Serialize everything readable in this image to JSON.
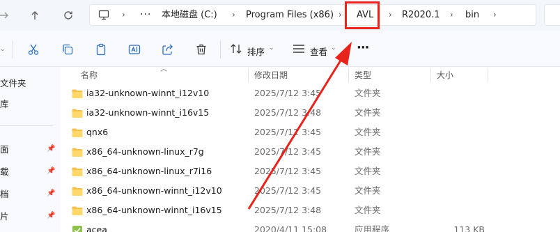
{
  "nav": {
    "forward_icon": "arrow-right-icon",
    "up_icon": "arrow-up-icon",
    "refresh_icon": "refresh-icon"
  },
  "address": {
    "more": "···",
    "segments": [
      "本地磁盘 (C:)",
      "Program Files (x86)",
      "AVL",
      "R2020.1",
      "bin"
    ],
    "highlighted_segment": "AVL"
  },
  "toolbar": {
    "sort_label": "排序",
    "view_label": "查看",
    "more_label": "···"
  },
  "sidebar": {
    "items": [
      {
        "label": "文件夹"
      },
      {
        "label": "库"
      },
      {
        "label": "面"
      },
      {
        "label": "载"
      },
      {
        "label": "档"
      },
      {
        "label": "片"
      }
    ]
  },
  "list": {
    "columns": {
      "name": "名称",
      "date": "修改日期",
      "type": "类型",
      "size": "大小"
    },
    "rows": [
      {
        "name": "ia32-unknown-winnt_i12v10",
        "date": "2025/7/12 3:45",
        "type": "文件夹",
        "size": "",
        "icon": "folder-icon"
      },
      {
        "name": "ia32-unknown-winnt_i16v15",
        "date": "2025/7/12 3:48",
        "type": "文件夹",
        "size": "",
        "icon": "folder-icon"
      },
      {
        "name": "qnx6",
        "date": "2025/7/12 3:45",
        "type": "文件夹",
        "size": "",
        "icon": "folder-icon"
      },
      {
        "name": "x86_64-unknown-linux_r7g",
        "date": "2025/7/12 3:45",
        "type": "文件夹",
        "size": "",
        "icon": "folder-icon"
      },
      {
        "name": "x86_64-unknown-linux_r7i16",
        "date": "2025/7/12 3:45",
        "type": "文件夹",
        "size": "",
        "icon": "folder-icon"
      },
      {
        "name": "x86_64-unknown-winnt_i12v10",
        "date": "2025/7/12 3:45",
        "type": "文件夹",
        "size": "",
        "icon": "folder-icon"
      },
      {
        "name": "x86_64-unknown-winnt_i16v15",
        "date": "2025/7/12 3:48",
        "type": "文件夹",
        "size": "",
        "icon": "folder-icon"
      },
      {
        "name": "acea",
        "date": "2020/4/11 15:08",
        "type": "应用程序",
        "size": "113 KB",
        "icon": "application-icon"
      }
    ]
  },
  "colors": {
    "annotation_red": "#e8231b",
    "folder_yellow": "#f2c14e"
  }
}
